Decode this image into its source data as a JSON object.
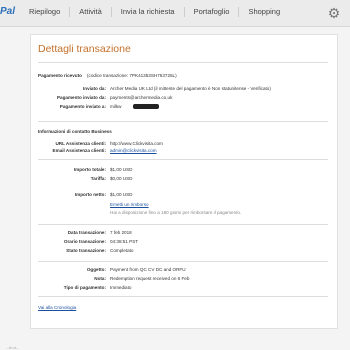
{
  "header": {
    "logo_text": "Pal",
    "nav": [
      "Riepilogo",
      "Attività",
      "Invia la richiesta",
      "Portafoglio",
      "Shopping"
    ]
  },
  "title": "Dettagli transazione",
  "payment": {
    "label": "Pagamento ricevuto",
    "code_text": "(codice transazione: 7PK41353SH753725L)",
    "rows": [
      {
        "label": "Inviato da:",
        "value": "Archer Media UK Ltd (il mittente del pagamento è Non statunitense - Verificato)"
      },
      {
        "label": "Pagamento inviato da:",
        "value": "payments@archermedia.co.uk"
      },
      {
        "label": "Pagamento inviato a:",
        "value": "milkw"
      }
    ]
  },
  "business": {
    "heading": "Informazioni di contatto Business",
    "url_label": "URL Assistenza clienti:",
    "url_value": "http://www.Clickvisita.com",
    "email_label": "Email Assistenza clienti:",
    "email_value": "admin@clickvisita.com"
  },
  "amounts": {
    "total_label": "Importo totale:",
    "total_value": "$1,00 USD",
    "fee_label": "Tariffa:",
    "fee_value": "$0,00 USD",
    "net_label": "Importo netto:",
    "net_value": "$1,00 USD",
    "refund_link": "Emetti un rimborso",
    "refund_note": "Hai a disposizione fino a 180 giorni per rimborsare il pagamento."
  },
  "details": {
    "date_label": "Data transazione:",
    "date_value": "7 feb 2018",
    "time_label": "Orario transazione:",
    "time_value": "04:38:51 PST",
    "status_label": "Stato transazione:",
    "status_value": "Completato"
  },
  "subject": {
    "object_label": "Oggetto:",
    "object_value": "Payment from QC CV DC and ORFU",
    "note_label": "Nota:",
    "note_value": "Redemption request received on 6 Feb",
    "type_label": "Tipo di pagamento:",
    "type_value": "Immediato"
  },
  "back_link": "Vai alla Cronologia",
  "footer_text": "...in d..."
}
